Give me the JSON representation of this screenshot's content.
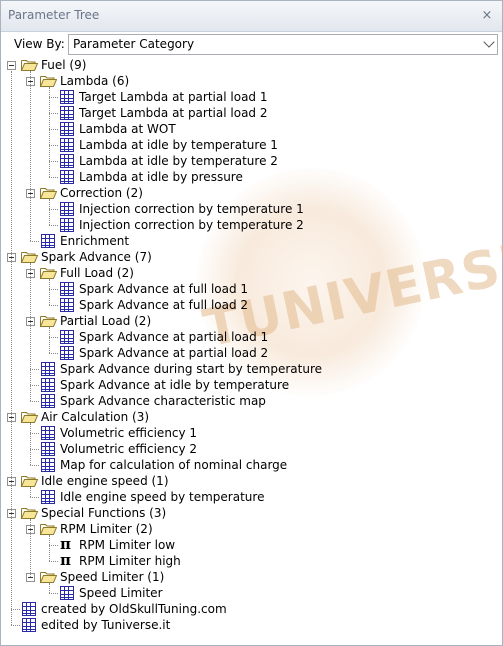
{
  "window": {
    "title": "Parameter Tree",
    "close_symbol": "×"
  },
  "viewby": {
    "label": "View By:",
    "selected": "Parameter Category"
  },
  "watermark": {
    "text": "TUNIVERSE"
  },
  "tree": [
    {
      "label": "Fuel (9)",
      "type": "folder"
    },
    {
      "label": "Lambda (6)",
      "type": "folder"
    },
    {
      "label": "Target Lambda at partial load 1",
      "type": "map"
    },
    {
      "label": "Target Lambda at partial load 2",
      "type": "map"
    },
    {
      "label": "Lambda at WOT",
      "type": "map"
    },
    {
      "label": "Lambda at idle by temperature 1",
      "type": "map"
    },
    {
      "label": "Lambda at idle by temperature 2",
      "type": "map"
    },
    {
      "label": "Lambda at idle by pressure",
      "type": "map"
    },
    {
      "label": "Correction (2)",
      "type": "folder"
    },
    {
      "label": "Injection correction by temperature 1",
      "type": "map"
    },
    {
      "label": "Injection correction by temperature 2",
      "type": "map"
    },
    {
      "label": "Enrichment",
      "type": "map"
    },
    {
      "label": "Spark Advance (7)",
      "type": "folder"
    },
    {
      "label": "Full Load (2)",
      "type": "folder"
    },
    {
      "label": "Spark Advance at full load 1",
      "type": "map"
    },
    {
      "label": "Spark Advance at full load 2",
      "type": "map"
    },
    {
      "label": "Partial Load (2)",
      "type": "folder"
    },
    {
      "label": "Spark Advance at partial load 1",
      "type": "map"
    },
    {
      "label": "Spark Advance at partial load 2",
      "type": "map"
    },
    {
      "label": "Spark Advance during start by temperature",
      "type": "map"
    },
    {
      "label": "Spark Advance at idle by temperature",
      "type": "map"
    },
    {
      "label": "Spark Advance characteristic map",
      "type": "map"
    },
    {
      "label": "Air Calculation (3)",
      "type": "folder"
    },
    {
      "label": "Volumetric efficiency 1",
      "type": "map"
    },
    {
      "label": "Volumetric efficiency 2",
      "type": "map"
    },
    {
      "label": "Map for calculation of nominal charge",
      "type": "map"
    },
    {
      "label": "Idle engine speed (1)",
      "type": "folder"
    },
    {
      "label": "Idle engine speed by temperature",
      "type": "map"
    },
    {
      "label": "Special Functions (3)",
      "type": "folder"
    },
    {
      "label": "RPM Limiter (2)",
      "type": "folder"
    },
    {
      "label": "RPM Limiter low",
      "type": "constant"
    },
    {
      "label": "RPM Limiter high",
      "type": "constant"
    },
    {
      "label": "Speed Limiter (1)",
      "type": "folder"
    },
    {
      "label": "Speed Limiter",
      "type": "map"
    },
    {
      "label": "created by OldSkullTuning.com",
      "type": "map"
    },
    {
      "label": "edited by Tuniverse.it",
      "type": "map"
    }
  ]
}
